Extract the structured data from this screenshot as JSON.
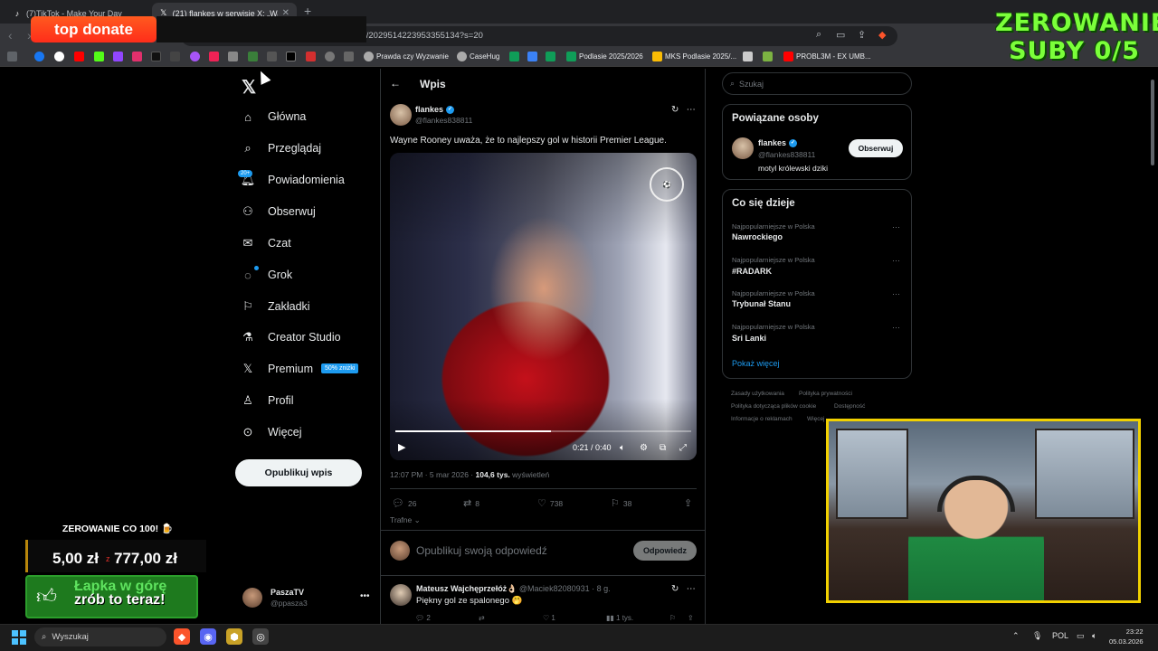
{
  "browser": {
    "tabs": [
      {
        "title": "(7)TikTok - Make Your Day",
        "icon": "tiktok-icon"
      },
      {
        "title": "(21) flankes w serwisie X: „Wayne",
        "icon": "x-icon"
      }
    ],
    "url": "s/2029514223953355134?s=20",
    "bookmarks": [
      "Prawda czy Wyzwanie",
      "CaseHug",
      "Podlasie 2025/2026",
      "MKS Podlasie 2025/...",
      "PROBL3M - EX UMB..."
    ]
  },
  "overlays": {
    "donate_label": "top donate",
    "counter_line1": "ZEROWANIE",
    "counter_line2": "SUBY 0/5",
    "goal_title": "ZEROWANIE CO 100! 🍺",
    "goal_current": "5,00 zł",
    "goal_sep": "z",
    "goal_target": "777,00 zł",
    "like_line1": "Łapka w górę",
    "like_line2": "zrób to teraz!"
  },
  "x_nav": {
    "items": [
      {
        "label": "Główna",
        "icon": "home-icon"
      },
      {
        "label": "Przeglądaj",
        "icon": "search-icon"
      },
      {
        "label": "Powiadomienia",
        "icon": "bell-icon"
      },
      {
        "label": "Obserwuj",
        "icon": "add-person-icon"
      },
      {
        "label": "Czat",
        "icon": "mail-icon"
      },
      {
        "label": "Grok",
        "icon": "grok-icon"
      },
      {
        "label": "Zakładki",
        "icon": "bookmark-icon"
      },
      {
        "label": "Creator Studio",
        "icon": "flask-icon"
      },
      {
        "label": "Premium",
        "icon": "x-icon"
      },
      {
        "label": "Profil",
        "icon": "person-icon"
      },
      {
        "label": "Więcej",
        "icon": "more-circle-icon"
      }
    ],
    "notif_badge": "20+",
    "premium_badge": "50% zniżki",
    "publish_label": "Opublikuj wpis",
    "account_name": "PaszaTV",
    "account_handle": "@ppasza3"
  },
  "post": {
    "page_title": "Wpis",
    "author_name": "flankes",
    "author_handle": "@flankes838811",
    "text": "Wayne Rooney uważa, że to najlepszy gol w historii Premier League.",
    "video_time": "0:21 / 0:40",
    "video_progress": 0.525,
    "time": "12:07 PM · 5 mar 2026 · ",
    "views": "104,6 tys.",
    "views_label": " wyświetleń",
    "replies": "26",
    "reposts": "8",
    "likes": "738",
    "bookmarks": "38",
    "filter": "Trafne",
    "reply_placeholder": "Opublikuj swoją odpowiedź",
    "reply_button": "Odpowiedz"
  },
  "comment": {
    "author": "Mateusz Wajchęprzełóż👌🏻",
    "meta": "@Maciek82080931 · 8 g.",
    "text": "Piękny gol ze spalonego 🤭",
    "replies": "2",
    "likes": "1",
    "views": "1 tys."
  },
  "sidebar": {
    "search_placeholder": "Szukaj",
    "related_title": "Powiązane osoby",
    "related_name": "flankes",
    "related_handle": "@flankes838811",
    "related_bio": "motyl królewski dziki",
    "follow_label": "Obserwuj",
    "trends_title": "Co się dzieje",
    "trends": [
      {
        "category": "Najpopularniejsze w Polska",
        "name": "Nawrockiego"
      },
      {
        "category": "Najpopularniejsze w Polska",
        "name": "#RADARK"
      },
      {
        "category": "Najpopularniejsze w Polska",
        "name": "Trybunał Stanu"
      },
      {
        "category": "Najpopularniejsze w Polska",
        "name": "Sri Lanki"
      }
    ],
    "show_more": "Pokaż więcej",
    "footer": [
      "Zasady użytkowania",
      "Polityka prywatności",
      "Polityka dotycząca plików cookie",
      "Dostępność",
      "Informacje o reklamach",
      "Więcej"
    ]
  },
  "taskbar": {
    "search_label": "Wyszukaj",
    "lang": "POL",
    "time": "23:22",
    "date": "05.03.2026"
  },
  "colors": {
    "accent": "#1d9bf0",
    "donate": "#ff3a1a",
    "counter": "#7bff3a",
    "cam_border": "#f2d100"
  }
}
